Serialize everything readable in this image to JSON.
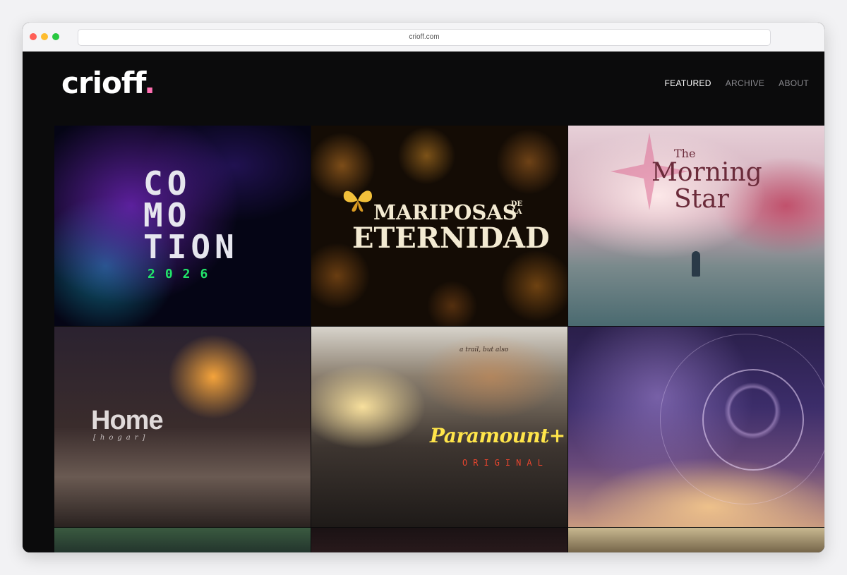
{
  "browser": {
    "url": "crioff.com"
  },
  "site": {
    "logo_text": "crioff",
    "logo_accent": ".",
    "accent_color": "#ff6fb1"
  },
  "nav": {
    "items": [
      {
        "label": "FEATURED",
        "active": true
      },
      {
        "label": "ARCHIVE",
        "active": false
      },
      {
        "label": "ABOUT",
        "active": false
      }
    ]
  },
  "tiles": {
    "commotion": {
      "line1": "CO",
      "line2": "MO",
      "line3": "TION",
      "year": "2026"
    },
    "mariposas": {
      "word1": "MARIPOSAS",
      "small": "DE LA",
      "word2": "ETERNIDAD"
    },
    "morning_star": {
      "the": "The",
      "morning": "Morning",
      "star": "Star"
    },
    "home": {
      "title": "Home",
      "subtitle": "[hogar]"
    },
    "paramount": {
      "brand": "Paramount+",
      "tag": "ORIGINAL",
      "handwriting": "a trail, but also"
    },
    "abstract": {}
  }
}
